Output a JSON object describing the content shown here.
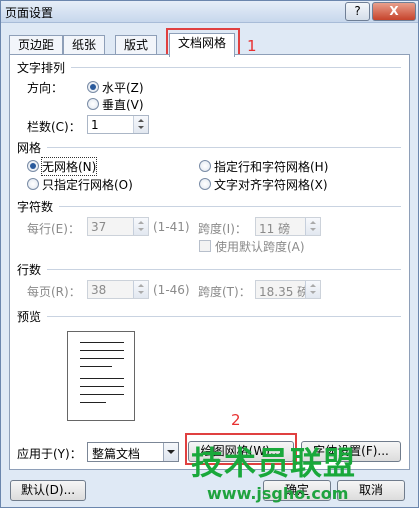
{
  "window": {
    "title": "页面设置",
    "help": "?",
    "close": "X"
  },
  "tabs": [
    "页边距",
    "纸张",
    "版式",
    "文档网格"
  ],
  "annotations": {
    "first": "1",
    "second": "2"
  },
  "text_direction": {
    "section": "文字排列",
    "direction_label": "方向：",
    "horizontal": "水平(Z)",
    "vertical": "垂直(V)",
    "columns_label": "栏数(C)：",
    "columns_value": "1"
  },
  "grid": {
    "section": "网格",
    "no_grid": "无网格(N)",
    "line_and_char": "指定行和字符网格(H)",
    "line_only": "只指定行网格(O)",
    "snap_to_chars": "文字对齐字符网格(X)"
  },
  "characters": {
    "section": "字符数",
    "per_line_label": "每行(E)：",
    "per_line_value": "37",
    "per_line_range": "(1-41)",
    "pitch_label": "跨度(I)：",
    "pitch_value": "11 磅",
    "use_default_pitch": "使用默认跨度(A)"
  },
  "lines": {
    "section": "行数",
    "per_page_label": "每页(R)：",
    "per_page_value": "38",
    "per_page_range": "(1-46)",
    "pitch_label": "跨度(T)：",
    "pitch_value": "18.35 磅"
  },
  "preview": {
    "section": "预览"
  },
  "apply": {
    "label": "应用于(Y)：",
    "value": "整篇文档",
    "draw_grid_button": "绘图网格(W)...",
    "font_settings_button": "字体设置(F)..."
  },
  "footer": {
    "default_button": "默认(D)...",
    "ok_button": "确定",
    "cancel_button": "取消"
  },
  "watermark": {
    "big": "技术员联盟",
    "small": "www.jsgho.com"
  }
}
